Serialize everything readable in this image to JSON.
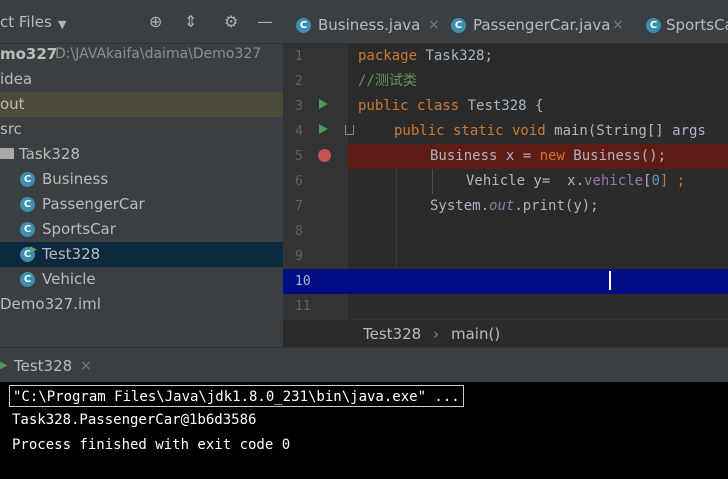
{
  "project_panel": {
    "title": "ct Files",
    "icons": [
      "dropdown-arrow-icon",
      "locate-target-icon",
      "collapse-all-icon",
      "settings-gear-icon",
      "hide-panel-icon"
    ],
    "tree": [
      {
        "label": "mo327",
        "path": "D:\\JAVAkaifa\\daima\\Demo327"
      },
      {
        "label": "idea"
      },
      {
        "label": "out"
      },
      {
        "label": "src"
      },
      {
        "label": "Task328"
      },
      {
        "label": "Business"
      },
      {
        "label": "PassengerCar"
      },
      {
        "label": "SportsCar"
      },
      {
        "label": "Test328"
      },
      {
        "label": "Vehicle"
      },
      {
        "label": "Demo327.iml"
      }
    ]
  },
  "tabs": [
    {
      "label": "Business.java",
      "close": "×"
    },
    {
      "label": "PassengerCar.java",
      "close": "×"
    },
    {
      "label": "SportsCa"
    }
  ],
  "class_icon_letter": "C",
  "line_numbers": [
    "1",
    "2",
    "3",
    "4",
    "5",
    "6",
    "7",
    "8",
    "9",
    "10",
    "11"
  ],
  "code": {
    "l1_kw": "package",
    "l1_rest": " Task328;",
    "l2": "//测试类",
    "l3_kw": "public class",
    "l3_rest": " Test328 {",
    "l4_kw": "public static void",
    "l4_rest": " main(String[] args",
    "l5_a": "Business x = ",
    "l5_kw": "new",
    "l5_b": " Business();",
    "l6_a": "Vehicle y=  x.",
    "l6_fld": "vehicle",
    "l6_b": "[",
    "l6_num": "0",
    "l6_c": "] ;",
    "l7_a": "System.",
    "l7_fld": "out",
    "l7_b": ".print(y);"
  },
  "breadcrumb": {
    "cls": "Test328",
    "sep": "›",
    "method": "main()"
  },
  "run": {
    "tab_label": "Test328",
    "tab_close": "×",
    "console": [
      "\"C:\\Program Files\\Java\\jdk1.8.0_231\\bin\\java.exe\" ...",
      "Task328.PassengerCar@1b6d3586",
      "Process finished with exit code 0"
    ]
  }
}
